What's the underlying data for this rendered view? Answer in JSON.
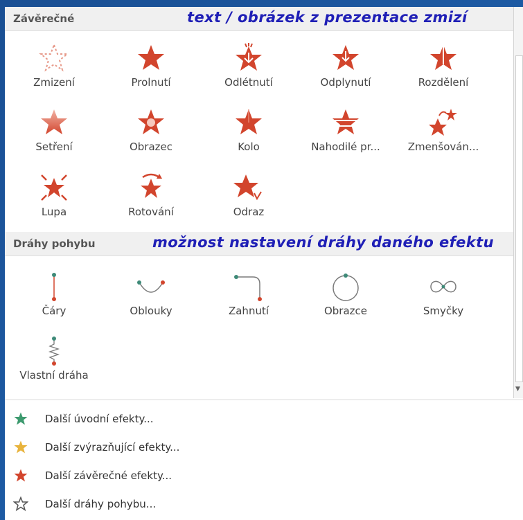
{
  "exit_section": {
    "title": "Závěrečné",
    "annotation": "text / obrázek z prezentace zmizí",
    "effects": [
      {
        "label": "Zmizení",
        "icon": "star-outline-icon"
      },
      {
        "label": "Prolnutí",
        "icon": "star-icon"
      },
      {
        "label": "Odlétnutí",
        "icon": "star-fly-icon"
      },
      {
        "label": "Odplynutí",
        "icon": "star-float-icon"
      },
      {
        "label": "Rozdělení",
        "icon": "star-split-icon"
      },
      {
        "label": "Setření",
        "icon": "star-wipe-icon"
      },
      {
        "label": "Obrazec",
        "icon": "star-shape-icon"
      },
      {
        "label": "Kolo",
        "icon": "star-wheel-icon"
      },
      {
        "label": "Nahodilé pr...",
        "icon": "star-random-bars-icon"
      },
      {
        "label": "Zmenšován...",
        "icon": "star-shrink-icon"
      },
      {
        "label": "Lupa",
        "icon": "star-zoom-icon"
      },
      {
        "label": "Rotování",
        "icon": "star-rotate-icon"
      },
      {
        "label": "Odraz",
        "icon": "star-bounce-icon"
      }
    ]
  },
  "motion_section": {
    "title": "Dráhy pohybu",
    "annotation": "možnost nastavení dráhy daného efektu",
    "paths": [
      {
        "label": "Čáry",
        "icon": "line-path-icon"
      },
      {
        "label": "Oblouky",
        "icon": "arc-path-icon"
      },
      {
        "label": "Zahnutí",
        "icon": "turn-path-icon"
      },
      {
        "label": "Obrazce",
        "icon": "circle-path-icon"
      },
      {
        "label": "Smyčky",
        "icon": "loop-path-icon"
      },
      {
        "label": "Vlastní dráha",
        "icon": "custom-path-icon"
      }
    ]
  },
  "more_menu": [
    {
      "label": "Další úvodní efekty...",
      "icon": "green-star-icon"
    },
    {
      "label": "Další zvýrazňující efekty...",
      "icon": "yellow-star-icon"
    },
    {
      "label": "Další závěrečné efekty...",
      "icon": "red-star-icon"
    },
    {
      "label": "Další dráhy pohybu...",
      "icon": "outline-star-icon"
    }
  ],
  "colors": {
    "exit_red": "#d2452d",
    "path_teal": "#3e8a78",
    "annotation_blue": "#1f1fb6",
    "entrance_green": "#3d9a6f",
    "emphasis_yellow": "#e8b33c"
  }
}
